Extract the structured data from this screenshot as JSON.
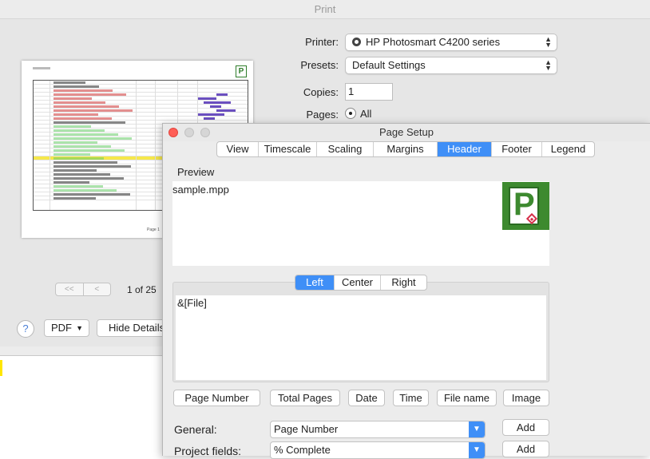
{
  "print_dialog": {
    "title": "Print",
    "printer_label": "Printer:",
    "printer_value": "HP Photosmart C4200 series",
    "presets_label": "Presets:",
    "presets_value": "Default Settings",
    "copies_label": "Copies:",
    "copies_value": "1",
    "pages_label": "Pages:",
    "pages_value": "All",
    "page_indicator": "1 of 25",
    "nav_first": "<<",
    "nav_prev": "<",
    "help_label": "?",
    "pdf_label": "PDF",
    "hide_details_label": "Hide Details"
  },
  "page_setup": {
    "title": "Page Setup",
    "tabs": [
      "View",
      "Timescale",
      "Scaling",
      "Margins",
      "Header",
      "Footer",
      "Legend"
    ],
    "active_tab": "Header",
    "preview_label": "Preview",
    "preview_text": "sample.mpp",
    "logo_letter": "P",
    "alignment_tabs": [
      "Left",
      "Center",
      "Right"
    ],
    "active_alignment": "Left",
    "header_text": "&[File]",
    "insert_buttons": [
      "Page Number",
      "Total Pages",
      "Date",
      "Time",
      "File name",
      "Image"
    ],
    "general_label": "General:",
    "general_value": "Page Number",
    "project_fields_label": "Project fields:",
    "project_fields_value": "% Complete",
    "add_label": "Add"
  },
  "colors": {
    "accent": "#3f8ff7",
    "logo_green": "#3d8a2f",
    "close_red": "#ff5f57"
  }
}
